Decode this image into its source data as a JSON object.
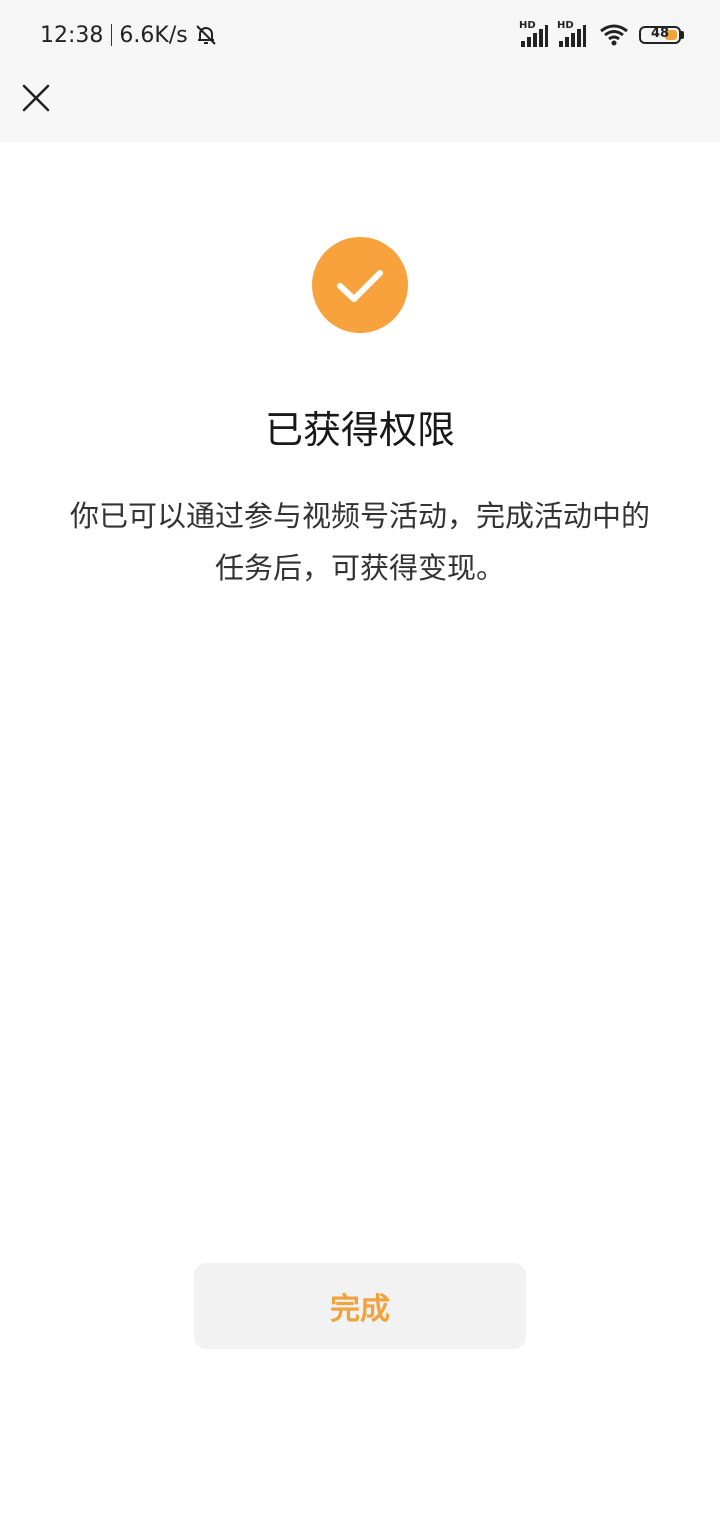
{
  "status_bar": {
    "time": "12:38",
    "net_speed": "6.6K/s",
    "battery_level": "48",
    "signal_labels": [
      "HD",
      "HD"
    ],
    "icons": [
      "mute-bell-icon",
      "signal-icon",
      "signal-icon",
      "wifi-icon",
      "battery-icon"
    ],
    "battery_color": "#f0a23a"
  },
  "nav": {
    "close_icon": "close-icon"
  },
  "result": {
    "icon": "check-circle-icon",
    "accent_color": "#f7a23c",
    "title": "已获得权限",
    "description": "你已可以通过参与视频号活动，完成活动中的任务后，可获得变现。"
  },
  "actions": {
    "done_label": "完成"
  }
}
